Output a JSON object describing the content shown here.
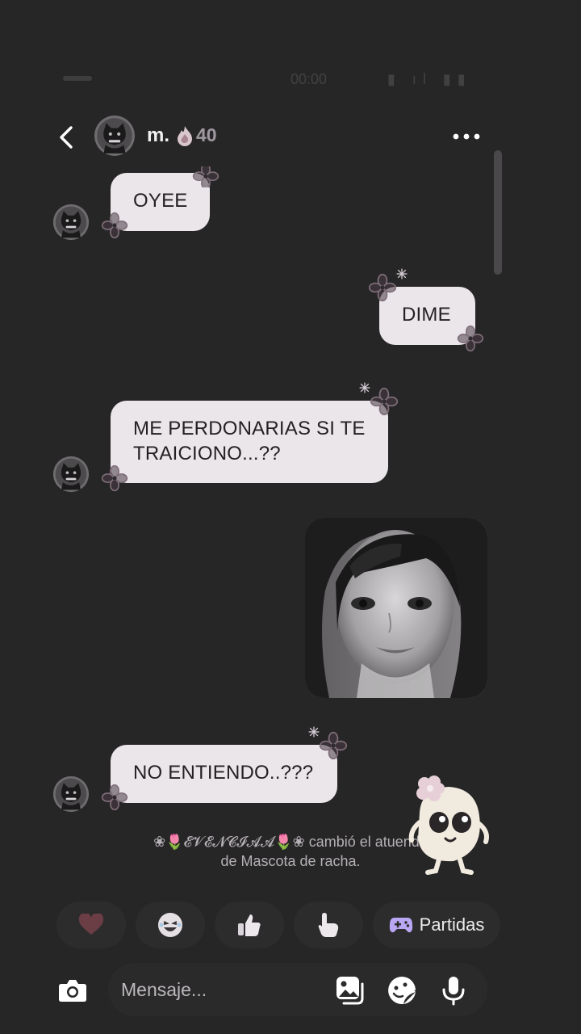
{
  "status_bar": {
    "time": "00:00",
    "icons": "signal-wifi-battery"
  },
  "header": {
    "back_icon": "chevron-left-icon",
    "contact_name": "m.",
    "streak_icon": "fire-icon",
    "streak_count": "40",
    "more_icon": "more-horizontal-icon"
  },
  "messages": [
    {
      "from": "contact",
      "text": "OYEE"
    },
    {
      "from": "me",
      "text": "DIME"
    },
    {
      "from": "contact",
      "text": "ME PERDONARIAS SI TE TRAICIONO...??"
    },
    {
      "from": "me",
      "type": "photo",
      "icon": "selfie-photo"
    },
    {
      "from": "contact",
      "text": "NO ENTIENDO..???"
    }
  ],
  "system_message": {
    "line1": "❀🌷𝓔𝓥𝓔𝓝𝓒𝓘𝓐𝓐🌷❀ cambió el atuendo",
    "line2": "de Mascota de racha."
  },
  "reactions": [
    {
      "icon": "heart-icon"
    },
    {
      "icon": "laughing-face-icon"
    },
    {
      "icon": "thumbs-up-icon"
    },
    {
      "icon": "pointing-hand-icon"
    },
    {
      "icon": "gamepad-icon",
      "label": "Partidas"
    }
  ],
  "composer": {
    "placeholder": "Mensaje...",
    "camera_icon": "camera-icon",
    "gallery_icon": "gallery-icon",
    "sticker_icon": "sticker-icon",
    "mic_icon": "microphone-icon"
  },
  "colors": {
    "background": "#272627",
    "bubble": "#ebe6ea",
    "bubble_text": "#232123",
    "accent_game": "#b9a7f3"
  }
}
